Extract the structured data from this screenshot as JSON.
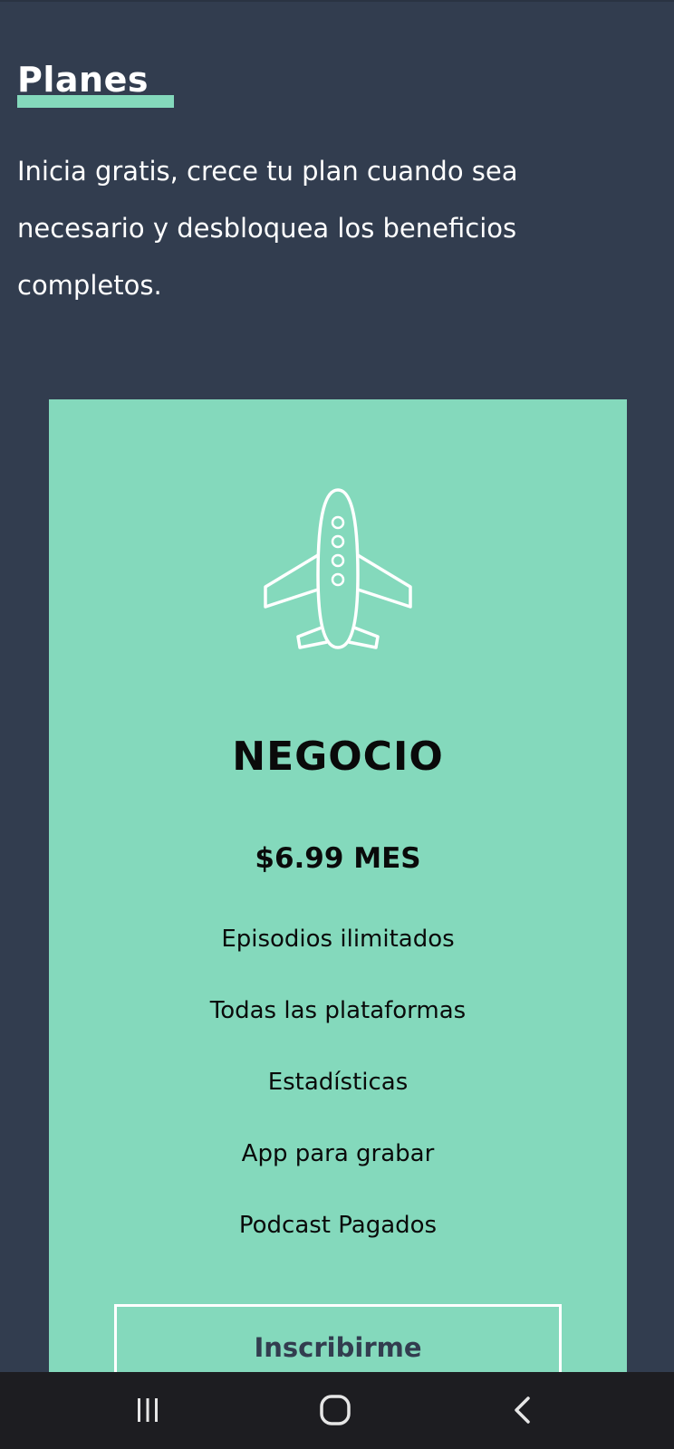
{
  "header": {
    "title": "Planes",
    "intro_lines": [
      "Inicia gratis, crece tu plan cuando sea",
      "necesario y desbloquea los beneficios",
      "completos."
    ]
  },
  "plan": {
    "icon": "airplane-icon",
    "name": "NEGOCIO",
    "price": "$6.99 MES",
    "features": [
      "Episodios ilimitados",
      "Todas las plataformas",
      "Estadísticas",
      "App para grabar",
      "Podcast Pagados"
    ],
    "cta_label": "Inscribirme"
  },
  "system_nav": {
    "recents_icon": "recent-apps-icon",
    "home_icon": "home-icon",
    "back_icon": "back-icon"
  },
  "colors": {
    "background": "#323d4f",
    "accent": "#84d9bc",
    "text_light": "#ffffff",
    "text_dark": "#0a0a0a",
    "navbar": "#1d1d21"
  }
}
